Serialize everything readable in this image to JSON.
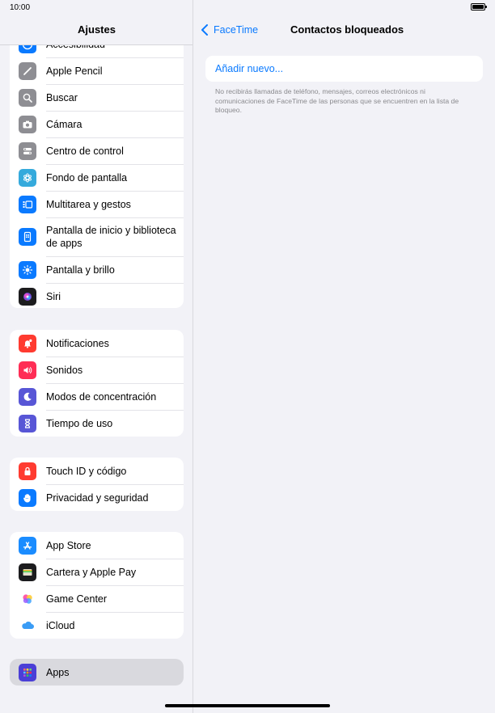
{
  "status_bar": {
    "time": "10:00"
  },
  "sidebar": {
    "title": "Ajustes",
    "groups": [
      {
        "items": [
          {
            "label": "Accesibilidad",
            "icon": "accessibility-icon",
            "color": "#0a7aff"
          },
          {
            "label": "Apple Pencil",
            "icon": "pencil-icon",
            "color": "#8e8e93"
          },
          {
            "label": "Buscar",
            "icon": "search-icon",
            "color": "#8e8e93"
          },
          {
            "label": "Cámara",
            "icon": "camera-icon",
            "color": "#8e8e93"
          },
          {
            "label": "Centro de control",
            "icon": "control-center-icon",
            "color": "#8e8e93"
          },
          {
            "label": "Fondo de pantalla",
            "icon": "wallpaper-icon",
            "color": "#35aadc"
          },
          {
            "label": "Multitarea y gestos",
            "icon": "multitasking-icon",
            "color": "#0a7aff"
          },
          {
            "label": "Pantalla de inicio y biblioteca de apps",
            "icon": "home-screen-icon",
            "color": "#0a7aff"
          },
          {
            "label": "Pantalla y brillo",
            "icon": "brightness-icon",
            "color": "#0a7aff"
          },
          {
            "label": "Siri",
            "icon": "siri-icon",
            "color": "#1c1c1e"
          }
        ]
      },
      {
        "items": [
          {
            "label": "Notificaciones",
            "icon": "notifications-icon",
            "color": "#ff3b30"
          },
          {
            "label": "Sonidos",
            "icon": "sounds-icon",
            "color": "#ff2d55"
          },
          {
            "label": "Modos de concentración",
            "icon": "focus-icon",
            "color": "#5856d6"
          },
          {
            "label": "Tiempo de uso",
            "icon": "screen-time-icon",
            "color": "#5856d6"
          }
        ]
      },
      {
        "items": [
          {
            "label": "Touch ID y código",
            "icon": "lock-icon",
            "color": "#ff3b30"
          },
          {
            "label": "Privacidad y seguridad",
            "icon": "hand-icon",
            "color": "#0a7aff"
          }
        ]
      },
      {
        "items": [
          {
            "label": "App Store",
            "icon": "app-store-icon",
            "color": "#1a8cff"
          },
          {
            "label": "Cartera y Apple Pay",
            "icon": "wallet-icon",
            "color": "#1c1c1e"
          },
          {
            "label": "Game Center",
            "icon": "game-center-icon",
            "color": "#ffffff"
          },
          {
            "label": "iCloud",
            "icon": "icloud-icon",
            "color": "#ffffff"
          }
        ]
      },
      {
        "items": [
          {
            "label": "Apps",
            "icon": "apps-icon",
            "color": "#4b3fd6",
            "selected": true
          }
        ]
      }
    ]
  },
  "detail": {
    "back_label": "FaceTime",
    "title": "Contactos bloqueados",
    "add_new": "Añadir nuevo...",
    "footnote": "No recibirás llamadas de teléfono, mensajes, correos electrónicos ni comunicaciones de FaceTime de las personas que se encuentren en la lista de bloqueo."
  },
  "colors": {
    "accent": "#0a7aff",
    "background": "#f2f2f7"
  }
}
